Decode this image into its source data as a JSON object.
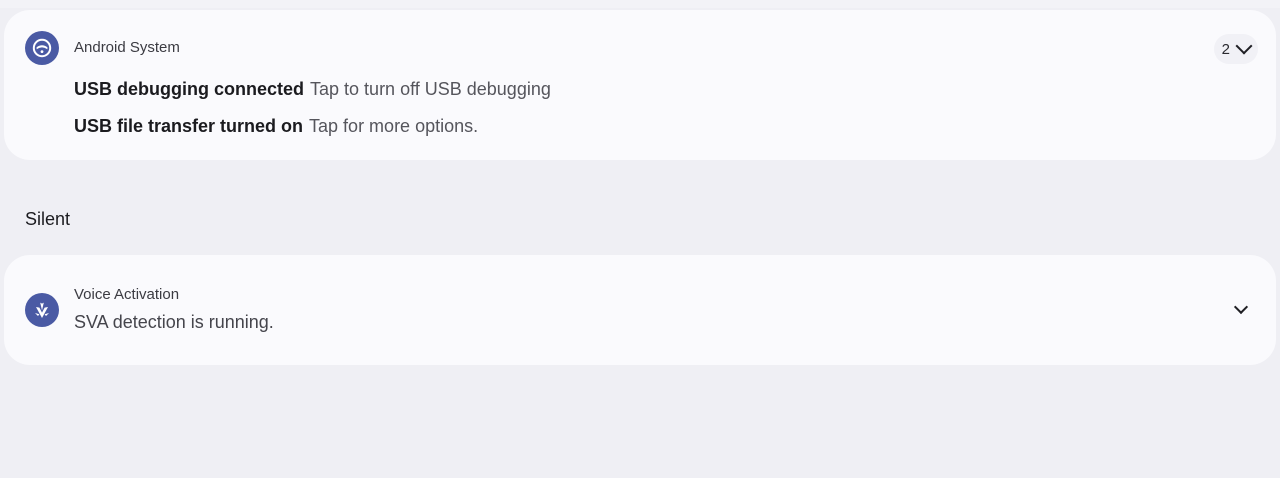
{
  "notifications": [
    {
      "app_name": "Android System",
      "icon": "android-system-icon",
      "count": "2",
      "rows": [
        {
          "title": "USB debugging connected",
          "text": "Tap to turn off USB debugging"
        },
        {
          "title": "USB file transfer turned on",
          "text": "Tap for more options."
        }
      ]
    }
  ],
  "silent_section": {
    "header": "Silent",
    "notification": {
      "app_name": "Voice Activation",
      "icon": "voice-activation-icon",
      "text": "SVA detection is running."
    }
  },
  "colors": {
    "background": "#efeff4",
    "card": "#fafafd",
    "icon_accent": "#4a5aa4"
  }
}
